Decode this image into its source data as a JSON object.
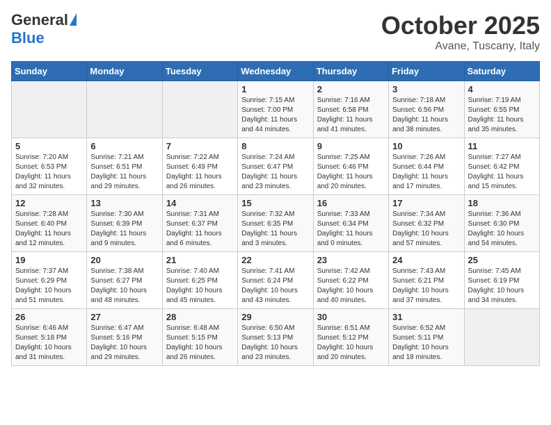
{
  "header": {
    "logo_general": "General",
    "logo_blue": "Blue",
    "month": "October 2025",
    "location": "Avane, Tuscany, Italy"
  },
  "weekdays": [
    "Sunday",
    "Monday",
    "Tuesday",
    "Wednesday",
    "Thursday",
    "Friday",
    "Saturday"
  ],
  "weeks": [
    [
      {
        "day": "",
        "info": ""
      },
      {
        "day": "",
        "info": ""
      },
      {
        "day": "",
        "info": ""
      },
      {
        "day": "1",
        "info": "Sunrise: 7:15 AM\nSunset: 7:00 PM\nDaylight: 11 hours and 44 minutes."
      },
      {
        "day": "2",
        "info": "Sunrise: 7:16 AM\nSunset: 6:58 PM\nDaylight: 11 hours and 41 minutes."
      },
      {
        "day": "3",
        "info": "Sunrise: 7:18 AM\nSunset: 6:56 PM\nDaylight: 11 hours and 38 minutes."
      },
      {
        "day": "4",
        "info": "Sunrise: 7:19 AM\nSunset: 6:55 PM\nDaylight: 11 hours and 35 minutes."
      }
    ],
    [
      {
        "day": "5",
        "info": "Sunrise: 7:20 AM\nSunset: 6:53 PM\nDaylight: 11 hours and 32 minutes."
      },
      {
        "day": "6",
        "info": "Sunrise: 7:21 AM\nSunset: 6:51 PM\nDaylight: 11 hours and 29 minutes."
      },
      {
        "day": "7",
        "info": "Sunrise: 7:22 AM\nSunset: 6:49 PM\nDaylight: 11 hours and 26 minutes."
      },
      {
        "day": "8",
        "info": "Sunrise: 7:24 AM\nSunset: 6:47 PM\nDaylight: 11 hours and 23 minutes."
      },
      {
        "day": "9",
        "info": "Sunrise: 7:25 AM\nSunset: 6:46 PM\nDaylight: 11 hours and 20 minutes."
      },
      {
        "day": "10",
        "info": "Sunrise: 7:26 AM\nSunset: 6:44 PM\nDaylight: 11 hours and 17 minutes."
      },
      {
        "day": "11",
        "info": "Sunrise: 7:27 AM\nSunset: 6:42 PM\nDaylight: 11 hours and 15 minutes."
      }
    ],
    [
      {
        "day": "12",
        "info": "Sunrise: 7:28 AM\nSunset: 6:40 PM\nDaylight: 11 hours and 12 minutes."
      },
      {
        "day": "13",
        "info": "Sunrise: 7:30 AM\nSunset: 6:39 PM\nDaylight: 11 hours and 9 minutes."
      },
      {
        "day": "14",
        "info": "Sunrise: 7:31 AM\nSunset: 6:37 PM\nDaylight: 11 hours and 6 minutes."
      },
      {
        "day": "15",
        "info": "Sunrise: 7:32 AM\nSunset: 6:35 PM\nDaylight: 11 hours and 3 minutes."
      },
      {
        "day": "16",
        "info": "Sunrise: 7:33 AM\nSunset: 6:34 PM\nDaylight: 11 hours and 0 minutes."
      },
      {
        "day": "17",
        "info": "Sunrise: 7:34 AM\nSunset: 6:32 PM\nDaylight: 10 hours and 57 minutes."
      },
      {
        "day": "18",
        "info": "Sunrise: 7:36 AM\nSunset: 6:30 PM\nDaylight: 10 hours and 54 minutes."
      }
    ],
    [
      {
        "day": "19",
        "info": "Sunrise: 7:37 AM\nSunset: 6:29 PM\nDaylight: 10 hours and 51 minutes."
      },
      {
        "day": "20",
        "info": "Sunrise: 7:38 AM\nSunset: 6:27 PM\nDaylight: 10 hours and 48 minutes."
      },
      {
        "day": "21",
        "info": "Sunrise: 7:40 AM\nSunset: 6:25 PM\nDaylight: 10 hours and 45 minutes."
      },
      {
        "day": "22",
        "info": "Sunrise: 7:41 AM\nSunset: 6:24 PM\nDaylight: 10 hours and 43 minutes."
      },
      {
        "day": "23",
        "info": "Sunrise: 7:42 AM\nSunset: 6:22 PM\nDaylight: 10 hours and 40 minutes."
      },
      {
        "day": "24",
        "info": "Sunrise: 7:43 AM\nSunset: 6:21 PM\nDaylight: 10 hours and 37 minutes."
      },
      {
        "day": "25",
        "info": "Sunrise: 7:45 AM\nSunset: 6:19 PM\nDaylight: 10 hours and 34 minutes."
      }
    ],
    [
      {
        "day": "26",
        "info": "Sunrise: 6:46 AM\nSunset: 5:18 PM\nDaylight: 10 hours and 31 minutes."
      },
      {
        "day": "27",
        "info": "Sunrise: 6:47 AM\nSunset: 5:16 PM\nDaylight: 10 hours and 29 minutes."
      },
      {
        "day": "28",
        "info": "Sunrise: 6:48 AM\nSunset: 5:15 PM\nDaylight: 10 hours and 26 minutes."
      },
      {
        "day": "29",
        "info": "Sunrise: 6:50 AM\nSunset: 5:13 PM\nDaylight: 10 hours and 23 minutes."
      },
      {
        "day": "30",
        "info": "Sunrise: 6:51 AM\nSunset: 5:12 PM\nDaylight: 10 hours and 20 minutes."
      },
      {
        "day": "31",
        "info": "Sunrise: 6:52 AM\nSunset: 5:11 PM\nDaylight: 10 hours and 18 minutes."
      },
      {
        "day": "",
        "info": ""
      }
    ]
  ]
}
